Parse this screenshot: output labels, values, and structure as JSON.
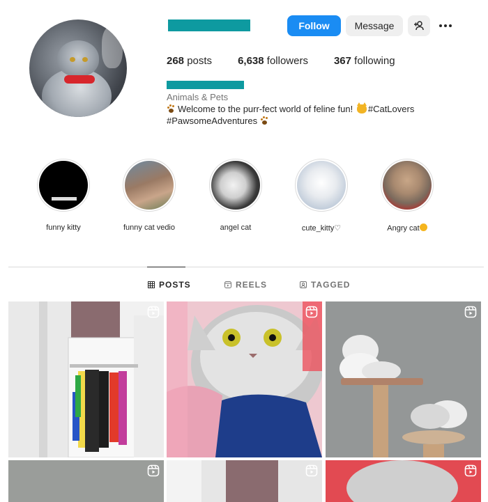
{
  "profile": {
    "actions": {
      "follow": "Follow",
      "message": "Message"
    },
    "stats": {
      "posts_count": "268",
      "posts_label": "posts",
      "followers_count": "6,638",
      "followers_label": "followers",
      "following_count": "367",
      "following_label": "following"
    },
    "category": "Animals & Pets",
    "bio": {
      "line1_text": "Welcome to the purr-fect world of feline fun!",
      "line1_tag": "#CatLovers",
      "line2_tag": "#PawsomeAdventures"
    }
  },
  "highlights": [
    {
      "label": "funny kitty"
    },
    {
      "label": "funny cat vedio"
    },
    {
      "label": "angel cat"
    },
    {
      "label": "cute_kitty♡"
    },
    {
      "label": "Angry cat"
    }
  ],
  "tabs": {
    "posts": "POSTS",
    "reels": "REELS",
    "tagged": "TAGGED",
    "active": "posts"
  },
  "colors": {
    "follow_button": "#1a8cf3",
    "redaction_bar": "#0e9aa0"
  },
  "icons": {
    "more": "ellipsis-icon",
    "suggest": "add-person-icon",
    "posts_tab": "grid-icon",
    "reels_tab": "reels-icon",
    "tagged_tab": "tagged-icon",
    "tile_badge": "reel-icon"
  }
}
